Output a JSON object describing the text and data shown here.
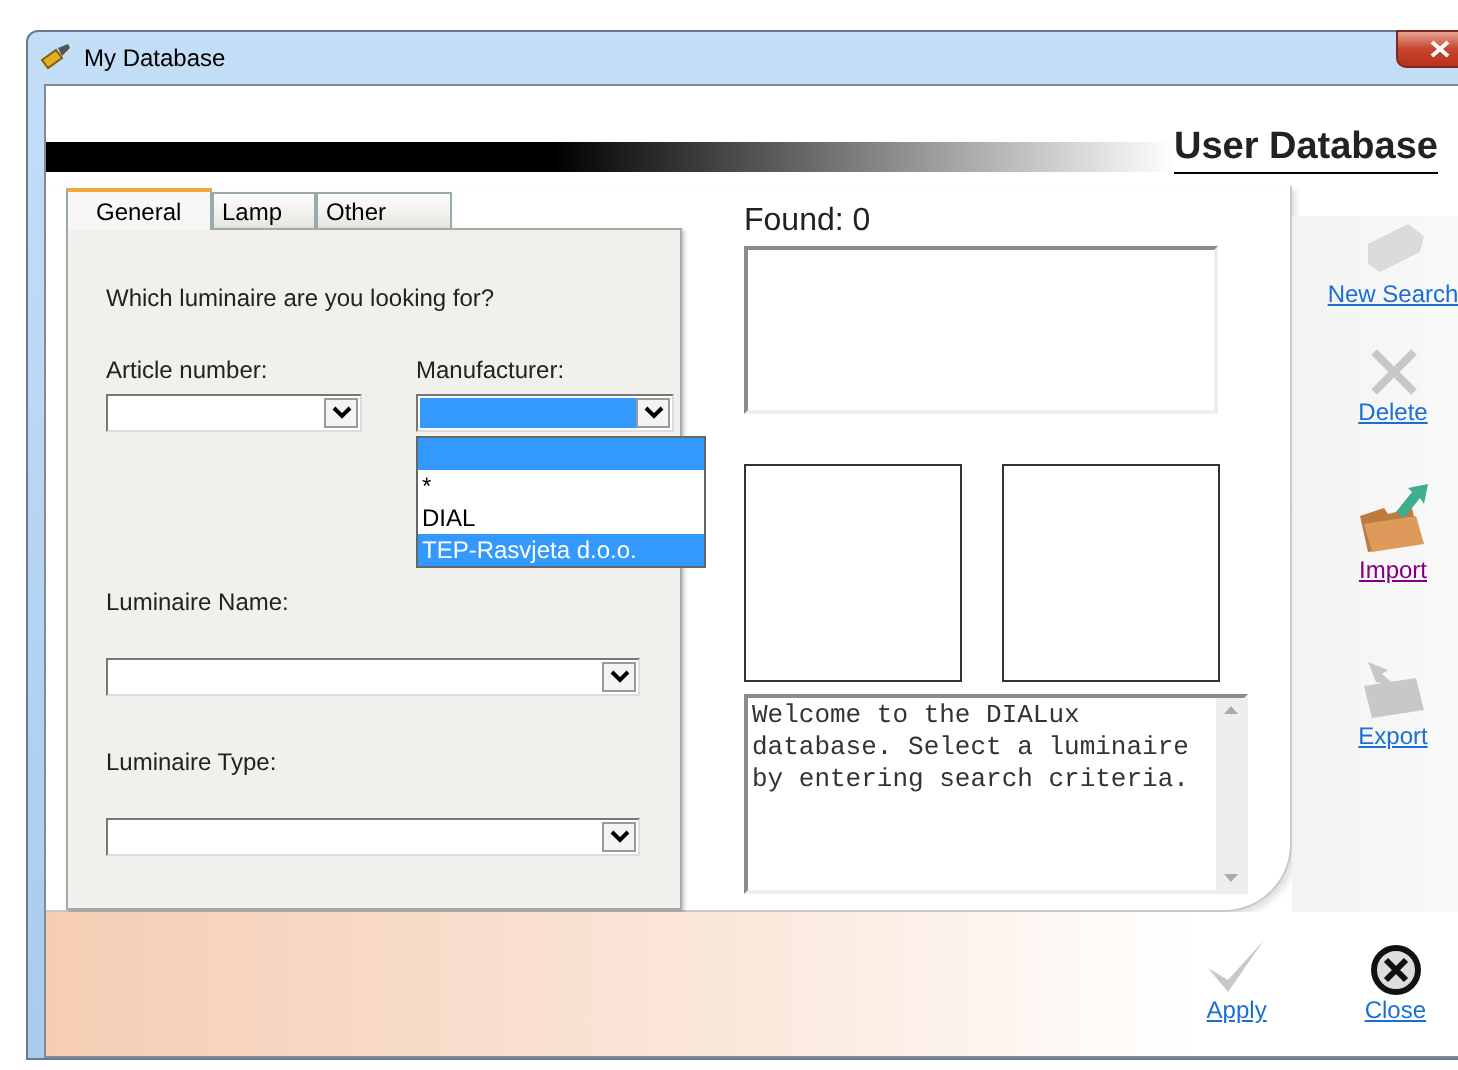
{
  "window": {
    "title": "My Database"
  },
  "header": {
    "title": "User Database"
  },
  "tabs": [
    {
      "label": "General",
      "selected": true
    },
    {
      "label": "Lamp",
      "selected": false
    },
    {
      "label": "Other",
      "selected": false
    }
  ],
  "general": {
    "question": "Which luminaire are you looking for?",
    "article_number": {
      "label": "Article number:",
      "focused": false
    },
    "manufacturer": {
      "label": "Manufacturer:",
      "focused": true,
      "open": true,
      "blank_option": {
        "highlighted": true
      },
      "options": [
        {
          "label": "*",
          "highlighted": false
        },
        {
          "label": "DIAL",
          "highlighted": false
        },
        {
          "label": "TEP-Rasvjeta d.o.o.",
          "highlighted": true
        }
      ]
    },
    "luminaire_name": {
      "label": "Luminaire Name:",
      "focused": false
    },
    "luminaire_type": {
      "label": "Luminaire Type:",
      "focused": false
    }
  },
  "results": {
    "found": "Found: 0",
    "message": "Welcome to the DIALux database. Select a luminaire by entering search criteria."
  },
  "actions": [
    {
      "kind": "new",
      "label": "New Search",
      "visited": false,
      "disabled": true
    },
    {
      "kind": "delete",
      "label": "Delete",
      "visited": false,
      "disabled": true
    },
    {
      "kind": "import",
      "label": "Import",
      "visited": true,
      "disabled": false
    },
    {
      "kind": "export",
      "label": "Export",
      "visited": false,
      "disabled": true
    }
  ],
  "footer": [
    {
      "kind": "apply",
      "label": "Apply",
      "disabled": true
    },
    {
      "kind": "close",
      "label": "Close",
      "disabled": false
    }
  ]
}
